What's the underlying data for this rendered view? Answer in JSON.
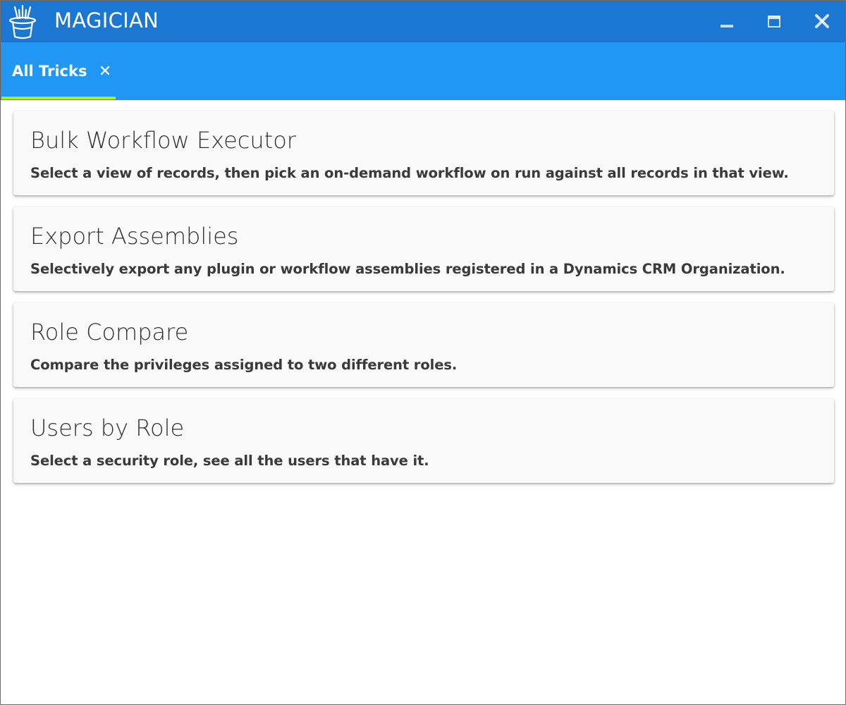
{
  "window": {
    "title": "MAGICIAN",
    "app_icon": "magic-hat-icon",
    "controls": {
      "minimize_icon": "minimize-icon",
      "maximize_icon": "maximize-icon",
      "close_icon": "close-icon"
    }
  },
  "tabs": [
    {
      "label": "All Tricks",
      "close_icon": "close-icon",
      "active": true
    }
  ],
  "tricks": [
    {
      "title": "Bulk Workflow Executor",
      "description": "Select a view of records, then pick an on-demand workflow on run against all records in that view."
    },
    {
      "title": "Export Assemblies",
      "description": "Selectively export any plugin or workflow assemblies registered in a Dynamics CRM Organization."
    },
    {
      "title": "Role Compare",
      "description": "Compare the privileges assigned to two different roles."
    },
    {
      "title": "Users by Role",
      "description": "Select a security role, see all the users that have it."
    }
  ],
  "colors": {
    "title_bar": "#1c77d2",
    "tab_bar": "#2196f3",
    "tab_indicator": "#a8ee0e",
    "card_background": "#f9f9f9"
  }
}
